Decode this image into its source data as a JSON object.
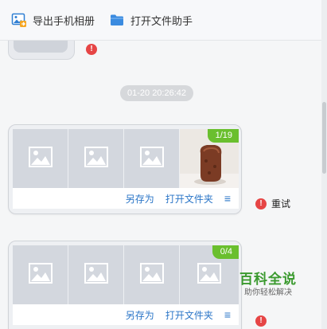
{
  "toolbar": {
    "export_label": "导出手机相册",
    "open_helper_label": "打开文件助手"
  },
  "chat": {
    "timestamp": "01-20 20:26:42",
    "groups": [
      {
        "badge": "1/19",
        "save_as": "另存为",
        "open_folder": "打开文件夹",
        "more_icon": "≡",
        "retry_label": "重试"
      },
      {
        "badge": "0/4",
        "save_as": "另存为",
        "open_folder": "打开文件夹",
        "more_icon": "≡"
      }
    ]
  },
  "icons": {
    "export": "export-image-icon",
    "folder": "folder-icon",
    "error": "!",
    "placeholder": "image-placeholder-icon"
  },
  "colors": {
    "link": "#2a75c7",
    "badge": "#6abf2e",
    "error": "#e64545",
    "watermark": "#3b9a2f"
  },
  "watermark": {
    "title": "百科全说",
    "subtitle": "助你轻松解决"
  }
}
